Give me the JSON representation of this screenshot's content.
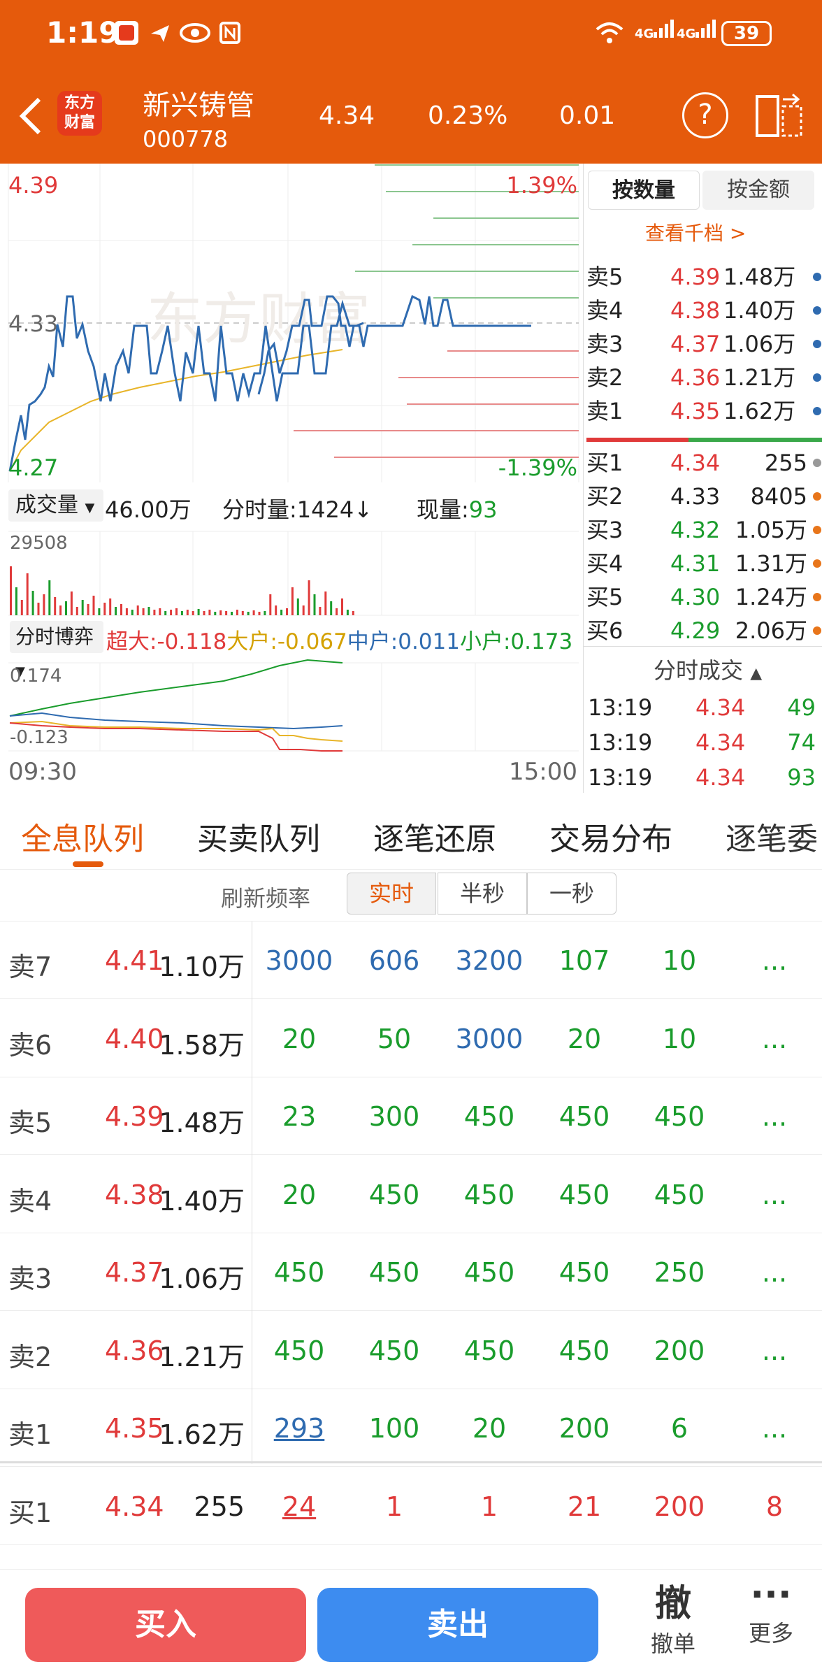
{
  "status": {
    "time": "1:19",
    "battery": "39",
    "net1": "4G",
    "net2": "4G"
  },
  "header": {
    "logo": "东方\n财富",
    "stock_name": "新兴铸管",
    "stock_code": "000778",
    "price": "4.34",
    "pct": "0.23%",
    "change": "0.01"
  },
  "chart": {
    "price_high": "4.39",
    "price_mid": "4.33",
    "price_low": "4.27",
    "pct_high": "1.39%",
    "pct_low": "-1.39%",
    "watermark": "东方财富",
    "vol_label": "成交量",
    "vol_total": "46.00万",
    "vol_minute": "分时量:1424↓",
    "vol_now_label": "现量:",
    "vol_now": "93",
    "vol_max": "29508",
    "fund_label": "分时博弈",
    "fund": [
      {
        "label": "超大:",
        "value": "-0.118",
        "color": "#e03a3a"
      },
      {
        "label": "大户:",
        "value": "-0.067",
        "color": "#d4a100"
      },
      {
        "label": "中户:",
        "value": "0.011",
        "color": "#2f6bb0"
      },
      {
        "label": "小户:",
        "value": "0.173",
        "color": "#1a9c2c"
      }
    ],
    "fund_max": "0.174",
    "fund_min": "-0.123",
    "time_start": "09:30",
    "time_end": "15:00"
  },
  "book": {
    "toggle_qty": "按数量",
    "toggle_amt": "按金额",
    "view_more": "查看千档 >",
    "sells": [
      {
        "label": "卖5",
        "price": "4.39",
        "qty": "1.48万"
      },
      {
        "label": "卖4",
        "price": "4.38",
        "qty": "1.40万"
      },
      {
        "label": "卖3",
        "price": "4.37",
        "qty": "1.06万"
      },
      {
        "label": "卖2",
        "price": "4.36",
        "qty": "1.21万"
      },
      {
        "label": "卖1",
        "price": "4.35",
        "qty": "1.62万"
      }
    ],
    "buys": [
      {
        "label": "买1",
        "price": "4.34",
        "qty": "255",
        "pcolor": "red",
        "dot": "#999"
      },
      {
        "label": "买2",
        "price": "4.33",
        "qty": "8405",
        "pcolor": "black",
        "dot": "#e8751a"
      },
      {
        "label": "买3",
        "price": "4.32",
        "qty": "1.05万",
        "pcolor": "green",
        "dot": "#e8751a"
      },
      {
        "label": "买4",
        "price": "4.31",
        "qty": "1.31万",
        "pcolor": "green",
        "dot": "#e8751a"
      },
      {
        "label": "买5",
        "price": "4.30",
        "qty": "1.24万",
        "pcolor": "green",
        "dot": "#e8751a"
      },
      {
        "label": "买6",
        "price": "4.29",
        "qty": "2.06万",
        "pcolor": "green",
        "dot": "#e8751a"
      }
    ],
    "trades_title": "分时成交",
    "trades": [
      {
        "time": "13:19",
        "price": "4.34",
        "qty": "49"
      },
      {
        "time": "13:19",
        "price": "4.34",
        "qty": "74"
      },
      {
        "time": "13:19",
        "price": "4.34",
        "qty": "93"
      }
    ]
  },
  "tabs": [
    "全息队列",
    "买卖队列",
    "逐笔还原",
    "交易分布",
    "逐笔委"
  ],
  "refresh": {
    "label": "刷新频率",
    "options": [
      "实时",
      "半秒",
      "一秒"
    ]
  },
  "queue": [
    {
      "label": "卖7",
      "price": "4.41",
      "qty": "1.10万",
      "vals": [
        "3000",
        "606",
        "3200",
        "107",
        "10",
        "..."
      ],
      "colors": [
        "blue",
        "blue",
        "blue",
        "green",
        "green",
        "green"
      ]
    },
    {
      "label": "卖6",
      "price": "4.40",
      "qty": "1.58万",
      "vals": [
        "20",
        "50",
        "3000",
        "20",
        "10",
        "..."
      ],
      "colors": [
        "green",
        "green",
        "blue",
        "green",
        "green",
        "green"
      ]
    },
    {
      "label": "卖5",
      "price": "4.39",
      "qty": "1.48万",
      "vals": [
        "23",
        "300",
        "450",
        "450",
        "450",
        "..."
      ],
      "colors": [
        "green",
        "green",
        "green",
        "green",
        "green",
        "green"
      ]
    },
    {
      "label": "卖4",
      "price": "4.38",
      "qty": "1.40万",
      "vals": [
        "20",
        "450",
        "450",
        "450",
        "450",
        "..."
      ],
      "colors": [
        "green",
        "green",
        "green",
        "green",
        "green",
        "green"
      ]
    },
    {
      "label": "卖3",
      "price": "4.37",
      "qty": "1.06万",
      "vals": [
        "450",
        "450",
        "450",
        "450",
        "250",
        "..."
      ],
      "colors": [
        "green",
        "green",
        "green",
        "green",
        "green",
        "green"
      ]
    },
    {
      "label": "卖2",
      "price": "4.36",
      "qty": "1.21万",
      "vals": [
        "450",
        "450",
        "450",
        "450",
        "200",
        "..."
      ],
      "colors": [
        "green",
        "green",
        "green",
        "green",
        "green",
        "green"
      ]
    },
    {
      "label": "卖1",
      "price": "4.35",
      "qty": "1.62万",
      "vals": [
        "293",
        "100",
        "20",
        "200",
        "6",
        "..."
      ],
      "colors": [
        "blue",
        "green",
        "green",
        "green",
        "green",
        "green"
      ]
    },
    {
      "label": "买1",
      "price": "4.34",
      "qty": "255",
      "vals": [
        "24",
        "1",
        "1",
        "21",
        "200",
        "8"
      ],
      "colors": [
        "red",
        "red",
        "red",
        "red",
        "red",
        "red"
      ]
    }
  ],
  "bottom": {
    "buy": "买入",
    "sell": "卖出",
    "cancel_icon": "撤",
    "cancel": "撤单",
    "more_icon": "···",
    "more": "更多"
  }
}
